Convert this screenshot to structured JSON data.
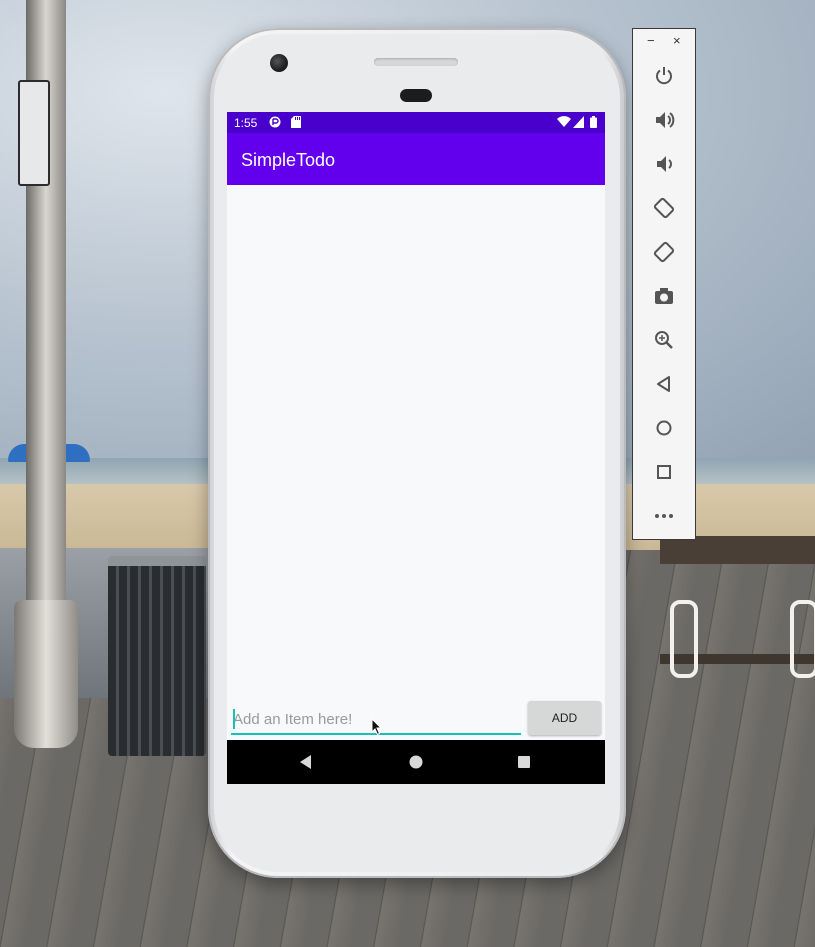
{
  "status_bar": {
    "time": "1:55"
  },
  "app_bar": {
    "title": "SimpleTodo"
  },
  "todo_list": {
    "items": []
  },
  "item_input": {
    "placeholder": "Add an Item here!",
    "value": ""
  },
  "add_button": {
    "label": "ADD"
  },
  "side_panel": {
    "minimize_label": "−",
    "close_label": "×",
    "buttons": [
      "power-icon",
      "volume-up-icon",
      "volume-down-icon",
      "rotate-left-icon",
      "rotate-right-icon",
      "camera-icon",
      "zoom-icon",
      "back-icon",
      "home-icon",
      "overview-icon",
      "more-icon"
    ]
  },
  "colors": {
    "status_bar": "#4a00cc",
    "app_bar": "#6200ee",
    "accent": "#17c0b0",
    "nav_bar": "#000000"
  }
}
